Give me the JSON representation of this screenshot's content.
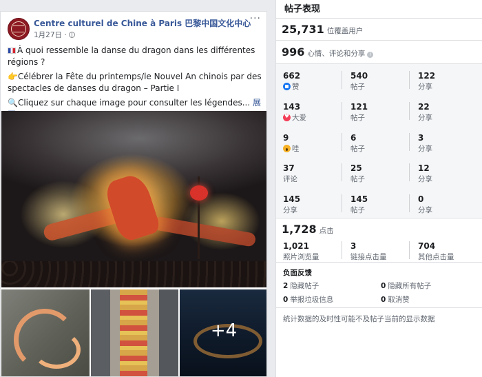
{
  "post": {
    "page_name": "Centre culturel de Chine à Paris 巴黎中国文化中心",
    "date": "1月27日 ·",
    "more_label": "···",
    "text": {
      "line1": "À quoi ressemble la danse du dragon dans les différentes régions ?",
      "line2": "👉Célébrer la Fête du printemps/le Nouvel An chinois par des spectacles de danses du dragon – Partie I",
      "line3": "🔍Cliquez sur chaque image pour consulter les légendes...",
      "see_more": "展开"
    },
    "more_photos": "+4"
  },
  "stats": {
    "title": "帖子表现",
    "reach": {
      "value": "25,731",
      "label": "位覆盖用户"
    },
    "engagement": {
      "value": "996",
      "label": "心情、评论和分享"
    },
    "rows": [
      [
        {
          "num": "662",
          "lbl": "赞",
          "icon": "like"
        },
        {
          "num": "540",
          "lbl": "帖子"
        },
        {
          "num": "122",
          "lbl": "分享"
        }
      ],
      [
        {
          "num": "143",
          "lbl": "大爱",
          "icon": "love"
        },
        {
          "num": "121",
          "lbl": "帖子"
        },
        {
          "num": "22",
          "lbl": "分享"
        }
      ],
      [
        {
          "num": "9",
          "lbl": "哇",
          "icon": "wow"
        },
        {
          "num": "6",
          "lbl": "帖子"
        },
        {
          "num": "3",
          "lbl": "分享"
        }
      ],
      [
        {
          "num": "37",
          "lbl": "评论"
        },
        {
          "num": "25",
          "lbl": "帖子"
        },
        {
          "num": "12",
          "lbl": "分享"
        }
      ],
      [
        {
          "num": "145",
          "lbl": "分享"
        },
        {
          "num": "145",
          "lbl": "帖子"
        },
        {
          "num": "0",
          "lbl": "分享"
        }
      ]
    ],
    "clicks": {
      "value": "1,728",
      "label": "点击",
      "items": [
        {
          "num": "1,021",
          "lbl": "照片浏览量"
        },
        {
          "num": "3",
          "lbl": "链接点击量"
        },
        {
          "num": "704",
          "lbl": "其他点击量"
        }
      ]
    },
    "negative": {
      "title": "负面反馈",
      "items": [
        {
          "num": "2",
          "lbl": "隐藏帖子"
        },
        {
          "num": "0",
          "lbl": "隐藏所有帖子"
        },
        {
          "num": "0",
          "lbl": "举报垃圾信息"
        },
        {
          "num": "0",
          "lbl": "取消赞"
        }
      ]
    },
    "footnote": "统计数据的及时性可能不及帖子当前的显示数据"
  }
}
